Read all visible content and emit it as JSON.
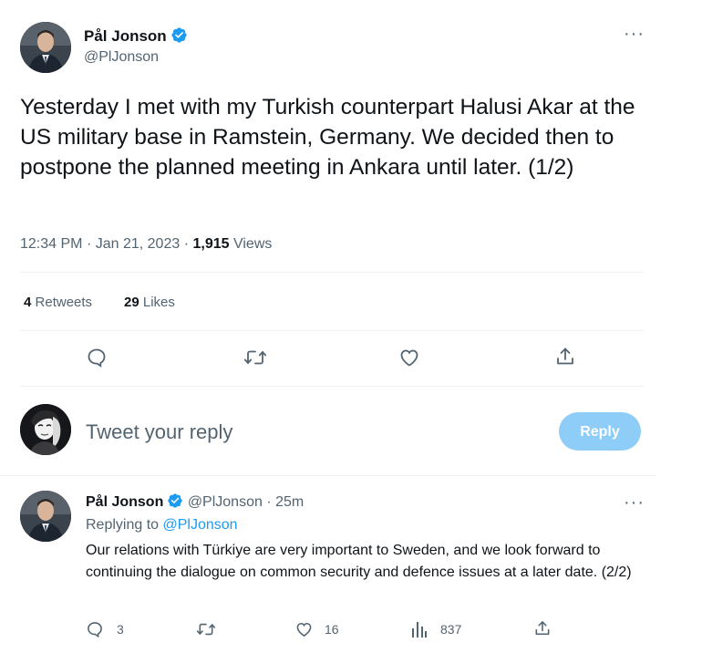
{
  "tweet": {
    "author_name": "Pål Jonson",
    "author_handle": "@PlJonson",
    "more_label": "···",
    "text": "Yesterday I met with my Turkish counterpart Halusi Akar at the US military base in Ramstein, Germany. We decided then to postpone the planned meeting in Ankara until later. (1/2)",
    "time": "12:34 PM",
    "date": "Jan 21, 2023",
    "views_count": "1,915",
    "views_label": "Views",
    "retweets_count": "4",
    "retweets_label": "Retweets",
    "likes_count": "29",
    "likes_label": "Likes"
  },
  "actions": {
    "icons": [
      "reply-icon",
      "retweet-icon",
      "like-icon",
      "share-icon"
    ]
  },
  "compose": {
    "placeholder": "Tweet your reply",
    "button_label": "Reply"
  },
  "reply": {
    "author_name": "Pål Jonson",
    "author_handle": "@PlJonson",
    "time_ago": "25m",
    "more_label": "···",
    "replying_prefix": "Replying to",
    "replying_handle": "@PlJonson",
    "text": "Our relations with Türkiye are very important to Sweden, and we look forward to continuing the dialogue on common security and defence issues at a later date. (2/2)",
    "reply_count": "3",
    "retweet_count": "",
    "like_count": "16",
    "views_count": "837"
  },
  "colors": {
    "accent": "#1d9bf0",
    "reply_button": "#8ecdf8",
    "secondary_text": "#536471",
    "divider": "#eff3f4"
  }
}
